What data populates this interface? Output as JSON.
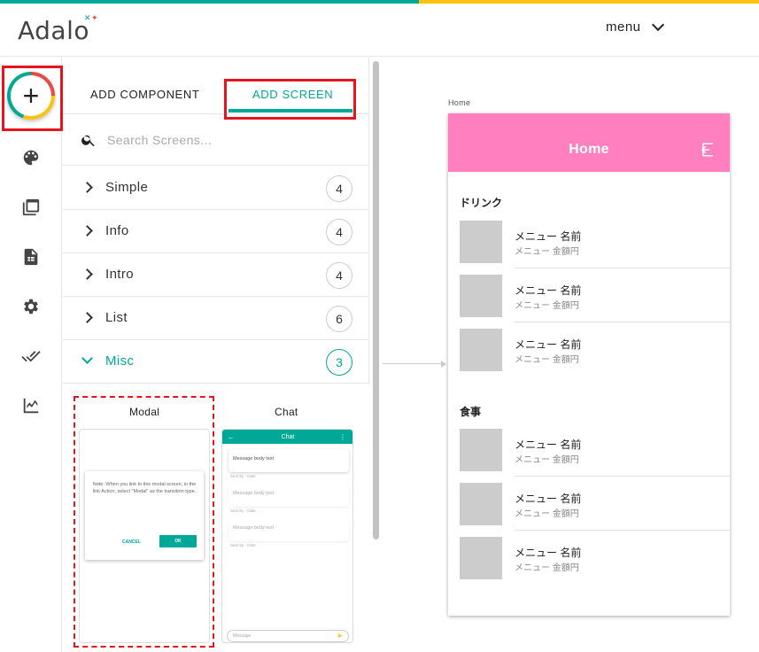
{
  "header": {
    "logo_text": "Adalo",
    "menu_label": "menu"
  },
  "tabs": {
    "add_component": "ADD COMPONENT",
    "add_screen": "ADD SCREEN"
  },
  "search": {
    "placeholder": "Search Screens..."
  },
  "categories": [
    {
      "label": "Simple",
      "count": "4"
    },
    {
      "label": "Info",
      "count": "4"
    },
    {
      "label": "Intro",
      "count": "4"
    },
    {
      "label": "List",
      "count": "6"
    },
    {
      "label": "Misc",
      "count": "3"
    }
  ],
  "templates": {
    "modal": {
      "title": "Modal",
      "note": "Note: When you link to this modal screen, in the link Action, select \"Modal\" as the transition type.",
      "cancel": "CANCEL",
      "ok": "OK"
    },
    "chat": {
      "title": "Chat",
      "bar_title": "Chat",
      "messages": [
        "Message body text",
        "Message body text",
        "Message body text"
      ],
      "sent": [
        "Sent by - Date",
        "Sent by - Date",
        "Sent by - Date"
      ],
      "input_placeholder": "Message"
    }
  },
  "canvas": {
    "screen_name": "Home",
    "phone_title": "Home",
    "sections": [
      {
        "title": "ドリンク",
        "items": [
          {
            "name": "メニュー 名前",
            "price": "メニュー 金額円"
          },
          {
            "name": "メニュー 名前",
            "price": "メニュー 金額円"
          },
          {
            "name": "メニュー 名前",
            "price": "メニュー 金額円"
          }
        ]
      },
      {
        "title": "食事",
        "items": [
          {
            "name": "メニュー 名前",
            "price": "メニュー 金額円"
          },
          {
            "name": "メニュー 名前",
            "price": "メニュー 金額円"
          },
          {
            "name": "メニュー 名前",
            "price": "メニュー 金額円"
          }
        ]
      }
    ]
  },
  "colors": {
    "accent": "#00a898",
    "brand_yellow": "#ffc00e",
    "header_pink": "#ff7fbf",
    "highlight_red": "#e8141c"
  }
}
